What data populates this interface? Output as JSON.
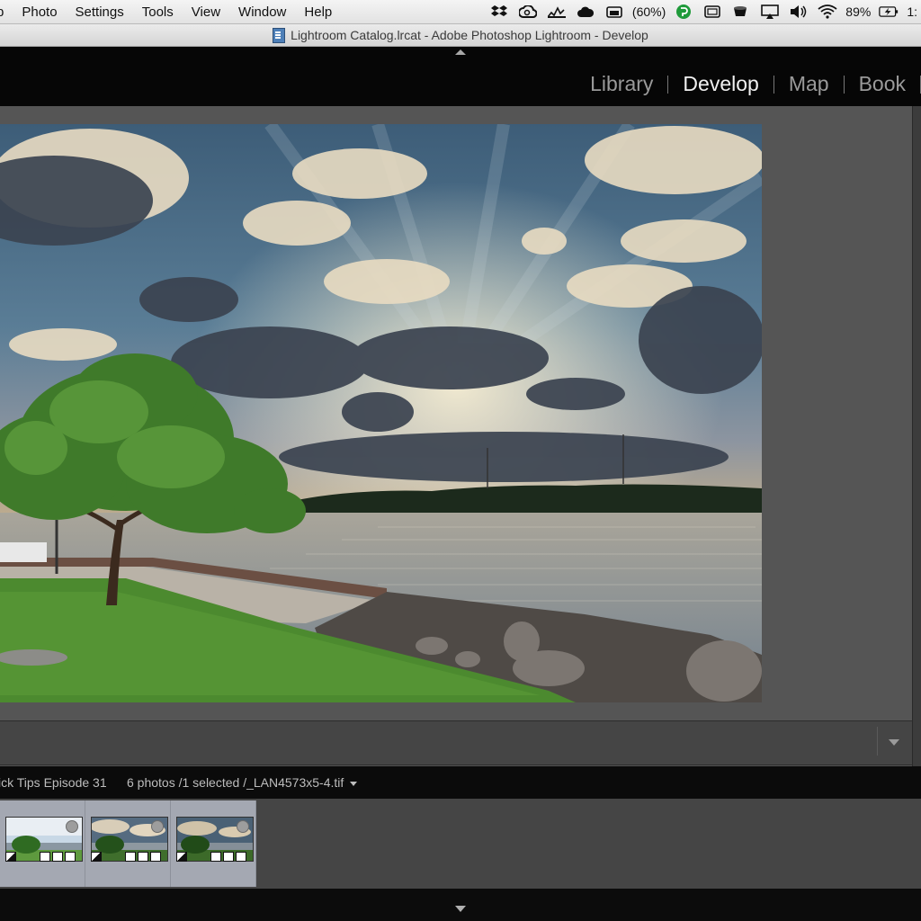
{
  "menubar": {
    "items": [
      "p",
      "Photo",
      "Settings",
      "Tools",
      "View",
      "Window",
      "Help"
    ],
    "status": {
      "icons": [
        "dropbox-icon",
        "creative-cloud-icon",
        "activity-monitor-icon",
        "cloud-icon",
        "battery-app-icon",
        "evernote-icon",
        "display-icon",
        "coffee-cup-icon",
        "airplay-icon",
        "volume-icon",
        "wifi-icon",
        "battery-icon"
      ],
      "memory_percent": "(60%)",
      "battery_percent": "89%",
      "clock": "1:"
    }
  },
  "window": {
    "title": "Lightroom Catalog.lrcat - Adobe Photoshop Lightroom - Develop"
  },
  "modules": {
    "items": [
      "Library",
      "Develop",
      "Map",
      "Book"
    ],
    "active": "Develop"
  },
  "filmstrip": {
    "source": "ick Tips Episode 31",
    "info": "6 photos /1 selected /_LAN4573x5-4.tif",
    "thumbnails": [
      {
        "variant": "bright"
      },
      {
        "variant": "dark"
      },
      {
        "variant": "dark"
      }
    ]
  },
  "colors": {
    "accent_active_module": "#f0f0f0",
    "inactive_module": "#9a9a9a",
    "filmstrip_selected": "#a4a8b2"
  }
}
